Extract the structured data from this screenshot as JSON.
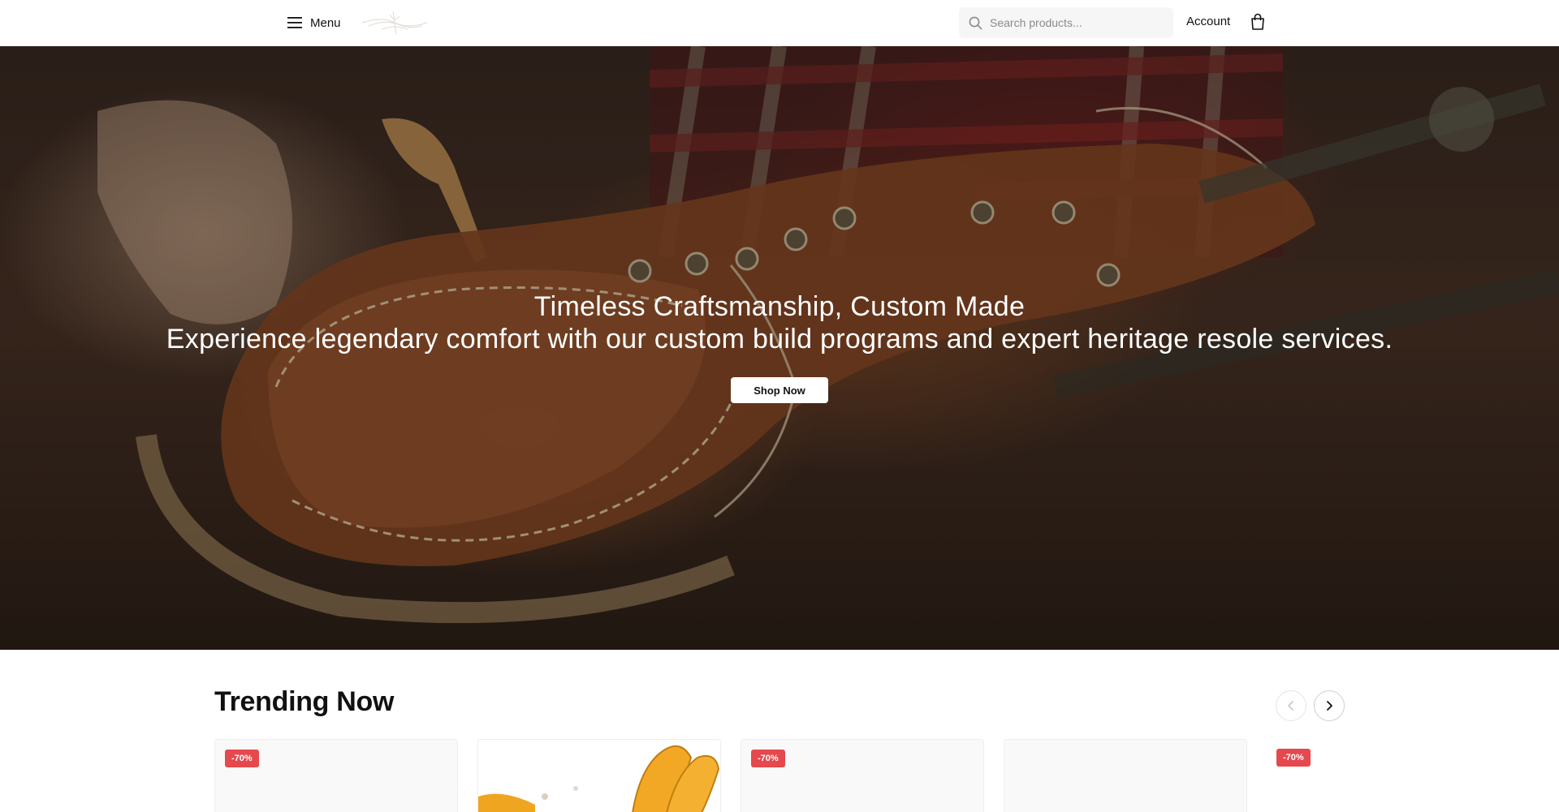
{
  "header": {
    "menu_label": "Menu",
    "search_placeholder": "Search products...",
    "account_label": "Account"
  },
  "hero": {
    "title": "Timeless Craftsmanship, Custom Made",
    "subtitle": "Experience legendary comfort with our custom build programs and expert heritage resole services.",
    "cta_label": "Shop Now"
  },
  "trending": {
    "title": "Trending Now",
    "products": [
      {
        "badge": "-70%"
      },
      {
        "badge": ""
      },
      {
        "badge": "-70%"
      },
      {
        "badge": ""
      },
      {
        "badge": "-70%"
      }
    ]
  },
  "colors": {
    "badge": "#e5484d",
    "accent_leather": "#8a4a26"
  },
  "icons": [
    "hamburger-menu-icon",
    "search-icon",
    "shopping-bag-icon",
    "chevron-left-icon",
    "chevron-right-icon"
  ]
}
